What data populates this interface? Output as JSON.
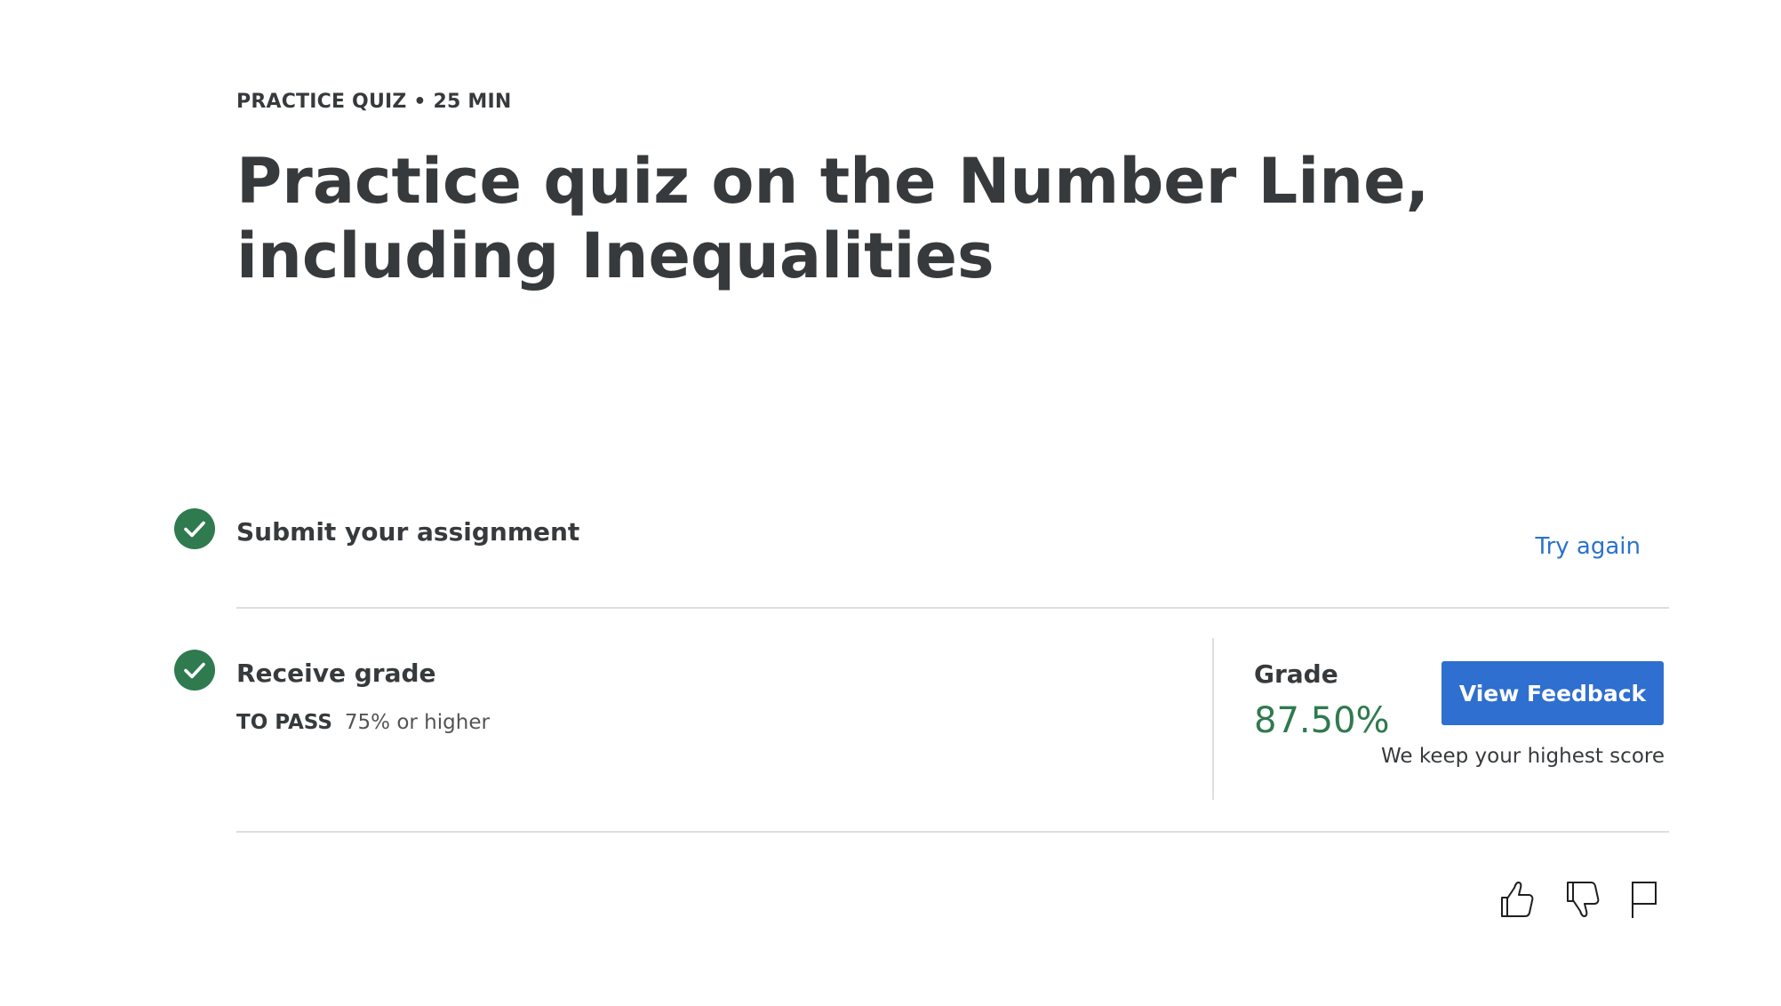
{
  "header": {
    "meta": "PRACTICE QUIZ • 25 MIN",
    "title": "Practice quiz on the Number Line, including Inequalities"
  },
  "steps": [
    {
      "title": "Submit your assignment",
      "status_icon": "check-circle-icon",
      "action_label": "Try again"
    },
    {
      "title": "Receive grade",
      "status_icon": "check-circle-icon",
      "pass_label": "TO PASS",
      "pass_value": "75% or higher"
    }
  ],
  "grade": {
    "label": "Grade",
    "value": "87.50%",
    "button_label": "View Feedback",
    "note": "We keep your highest score"
  },
  "actions": {
    "icons": [
      "thumbs-up-icon",
      "thumbs-down-icon",
      "flag-icon"
    ]
  },
  "colors": {
    "success": "#2f7a4f",
    "link": "#2a73cc",
    "button": "#2e6fcf",
    "text": "#373a3c"
  }
}
